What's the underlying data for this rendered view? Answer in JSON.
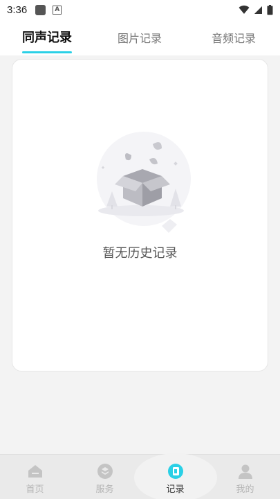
{
  "status_bar": {
    "time": "3:36"
  },
  "tabs": [
    {
      "label": "同声记录",
      "active": true
    },
    {
      "label": "图片记录",
      "active": false
    },
    {
      "label": "音频记录",
      "active": false
    }
  ],
  "empty_state": {
    "message": "暂无历史记录"
  },
  "bottom_nav": [
    {
      "label": "首页",
      "icon": "home-icon",
      "active": false
    },
    {
      "label": "服务",
      "icon": "service-icon",
      "active": false
    },
    {
      "label": "记录",
      "icon": "records-icon",
      "active": true
    },
    {
      "label": "我的",
      "icon": "profile-icon",
      "active": false
    }
  ],
  "colors": {
    "accent": "#2ad0e6",
    "background": "#f3f3f3",
    "card": "#ffffff"
  }
}
